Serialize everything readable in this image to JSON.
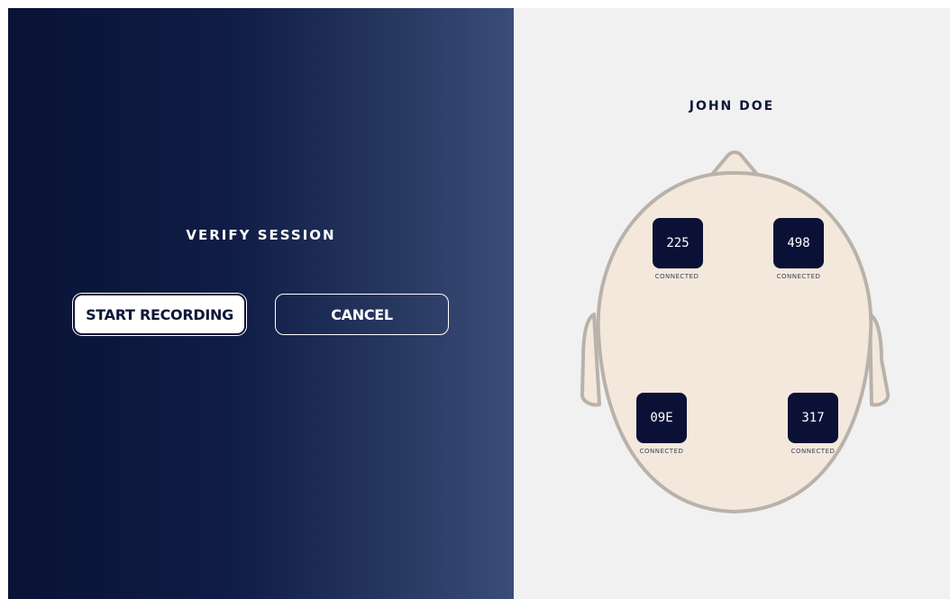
{
  "session": {
    "title": "VERIFY SESSION",
    "start_label": "START RECORDING",
    "cancel_label": "CANCEL"
  },
  "user": {
    "name": "JOHN DOE"
  },
  "sensors": [
    {
      "id": "225",
      "status": "CONNECTED"
    },
    {
      "id": "498",
      "status": "CONNECTED"
    },
    {
      "id": "09E",
      "status": "CONNECTED"
    },
    {
      "id": "317",
      "status": "CONNECTED"
    }
  ],
  "colors": {
    "panel_dark": "#0a1235",
    "panel_light": "#3a4d78",
    "head_fill": "#f4e8dc",
    "head_stroke": "#b9b2ab",
    "sensor_bg": "#0b1136"
  }
}
